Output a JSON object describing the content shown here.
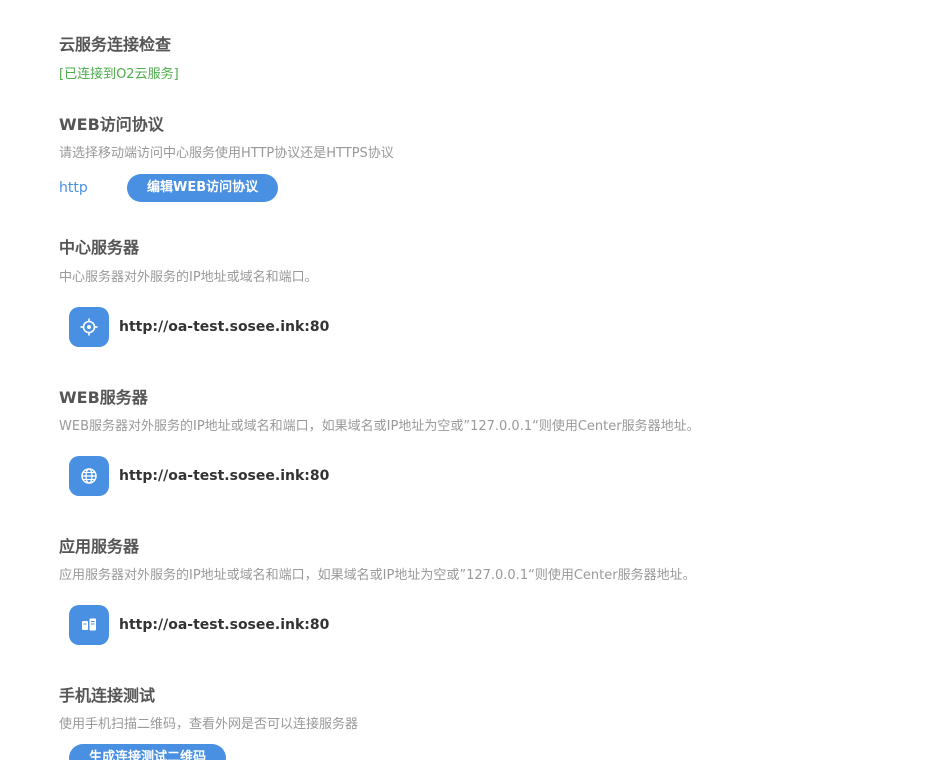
{
  "cloud": {
    "title": "云服务连接检查",
    "status": "[已连接到O2云服务]",
    "status_color": "#4cae4c"
  },
  "web_protocol": {
    "title": "WEB访问协议",
    "description": "请选择移动端访问中心服务使用HTTP协议还是HTTPS协议",
    "value": "http",
    "edit_button": "编辑WEB访问协议"
  },
  "center_server": {
    "title": "中心服务器",
    "description": "中心服务器对外服务的IP地址或域名和端口。",
    "icon": "target-icon",
    "address": "http://oa-test.sosee.ink:80"
  },
  "web_server": {
    "title": "WEB服务器",
    "description": "WEB服务器对外服务的IP地址或域名和端口，如果域名或IP地址为空或”127.0.0.1“则使用Center服务器地址。",
    "icon": "globe-icon",
    "address": "http://oa-test.sosee.ink:80"
  },
  "app_server": {
    "title": "应用服务器",
    "description": "应用服务器对外服务的IP地址或域名和端口，如果域名或IP地址为空或”127.0.0.1“则使用Center服务器地址。",
    "icon": "server-icon",
    "address": "http://oa-test.sosee.ink:80"
  },
  "mobile_test": {
    "title": "手机连接测试",
    "description": "使用手机扫描二维码，查看外网是否可以连接服务器",
    "generate_button": "生成连接测试二维码"
  },
  "colors": {
    "accent": "#4a90e2",
    "title_text": "#555555",
    "description_text": "#999999"
  }
}
